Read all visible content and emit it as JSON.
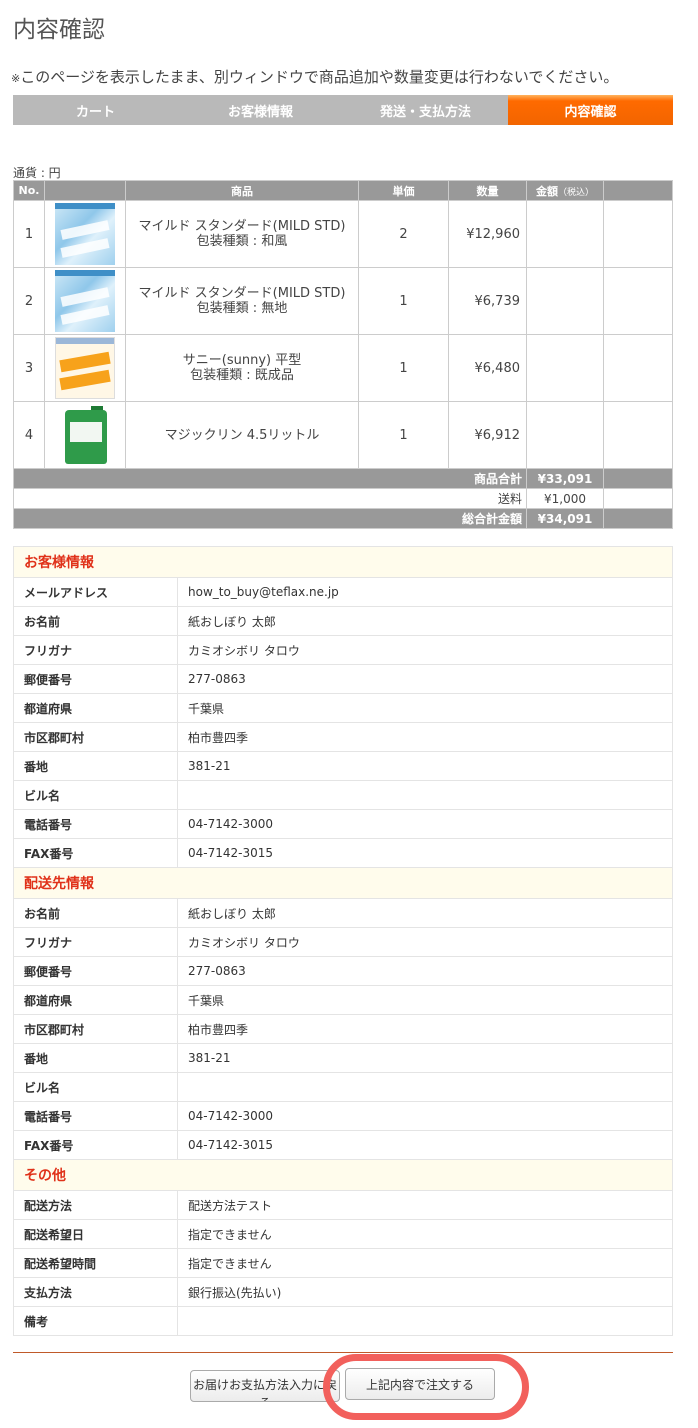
{
  "page_title": "内容確認",
  "notice_mark": "※",
  "notice_text": "このページを表示したまま、別ウィンドウで商品追加や数量変更は行わないでください。",
  "steps": [
    {
      "label": "カート",
      "active": false
    },
    {
      "label": "お客様情報",
      "active": false
    },
    {
      "label": "発送・支払方法",
      "active": false
    },
    {
      "label": "内容確認",
      "active": true
    }
  ],
  "currency_label": "通貨 : 円",
  "cart": {
    "headers": {
      "no": "No.",
      "product": "商品",
      "unit_price": "単価",
      "quantity": "数量",
      "amount": "金額",
      "amount_note": "（税込）"
    },
    "items": [
      {
        "no": "1",
        "image": "mild-std-image",
        "name": "マイルド スタンダード(MILD STD)",
        "option": "包装種類 : 和風",
        "unit_price": "2",
        "quantity": "¥12,960"
      },
      {
        "no": "2",
        "image": "mild-std-image",
        "name": "マイルド スタンダード(MILD STD)",
        "option": "包装種類 : 無地",
        "unit_price": "1",
        "quantity": "¥6,739"
      },
      {
        "no": "3",
        "image": "sunny-image",
        "name": "サニー(sunny) 平型",
        "option": "包装種類 : 既成品",
        "unit_price": "1",
        "quantity": "¥6,480"
      },
      {
        "no": "4",
        "image": "magiclean-image",
        "name": "マジックリン 4.5リットル",
        "option": "",
        "unit_price": "1",
        "quantity": "¥6,912"
      }
    ],
    "subtotal_label": "商品合計",
    "subtotal": "¥33,091",
    "shipping_label": "送料",
    "shipping": "¥1,000",
    "total_label": "総合計金額",
    "total": "¥34,091"
  },
  "customer": {
    "section": "お客様情報",
    "rows": [
      {
        "k": "メールアドレス",
        "v": "how_to_buy@teflax.ne.jp"
      },
      {
        "k": "お名前",
        "v": "紙おしぼり 太郎"
      },
      {
        "k": "フリガナ",
        "v": "カミオシボリ タロウ"
      },
      {
        "k": "郵便番号",
        "v": "277-0863"
      },
      {
        "k": "都道府県",
        "v": "千葉県"
      },
      {
        "k": "市区郡町村",
        "v": "柏市豊四季"
      },
      {
        "k": "番地",
        "v": "381-21"
      },
      {
        "k": "ビル名",
        "v": ""
      },
      {
        "k": "電話番号",
        "v": "04-7142-3000"
      },
      {
        "k": "FAX番号",
        "v": "04-7142-3015"
      }
    ]
  },
  "delivery": {
    "section": "配送先情報",
    "rows": [
      {
        "k": "お名前",
        "v": "紙おしぼり 太郎"
      },
      {
        "k": "フリガナ",
        "v": "カミオシボリ タロウ"
      },
      {
        "k": "郵便番号",
        "v": "277-0863"
      },
      {
        "k": "都道府県",
        "v": "千葉県"
      },
      {
        "k": "市区郡町村",
        "v": "柏市豊四季"
      },
      {
        "k": "番地",
        "v": "381-21"
      },
      {
        "k": "ビル名",
        "v": ""
      },
      {
        "k": "電話番号",
        "v": "04-7142-3000"
      },
      {
        "k": "FAX番号",
        "v": "04-7142-3015"
      }
    ]
  },
  "other": {
    "section": "その他",
    "rows": [
      {
        "k": "配送方法",
        "v": "配送方法テスト"
      },
      {
        "k": "配送希望日",
        "v": "指定できません"
      },
      {
        "k": "配送希望時間",
        "v": "指定できません"
      },
      {
        "k": "支払方法",
        "v": "銀行振込(先払い)"
      },
      {
        "k": "備考",
        "v": ""
      }
    ]
  },
  "buttons": {
    "back": "お届けお支払方法入力に戻る",
    "order": "上記内容で注文する"
  },
  "colors": {
    "accent": "#ff6a00",
    "section_text": "#e0321a",
    "highlight": "#f2605c"
  }
}
